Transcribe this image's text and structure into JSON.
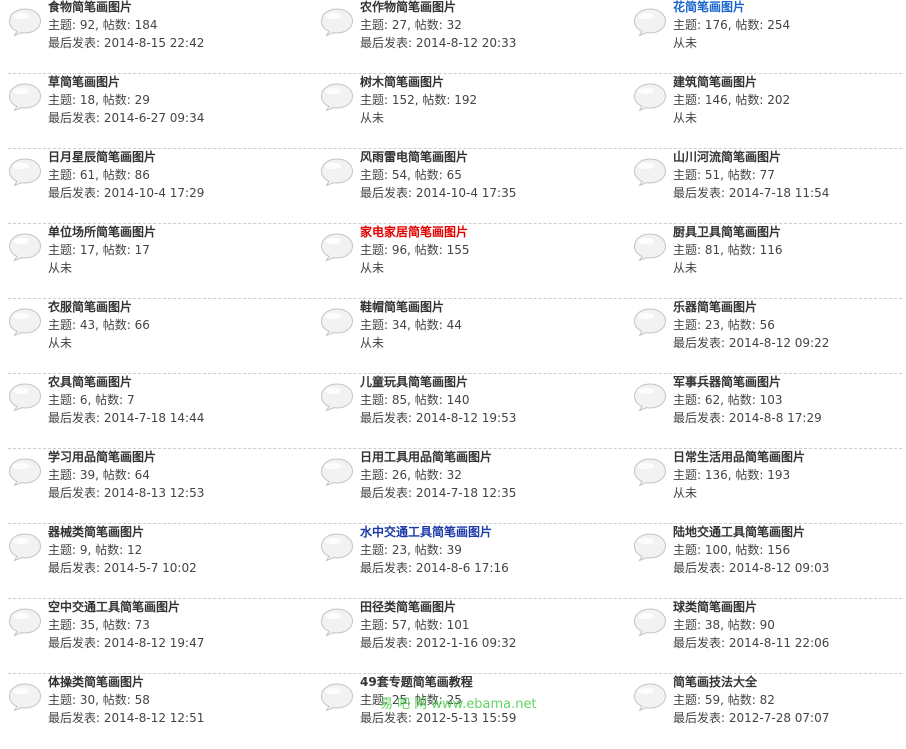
{
  "colors": {
    "title_default": "#333333",
    "title_blue": "#1a66cc",
    "title_red": "#e00000",
    "title_navy": "#1a3aa8",
    "bubble_fill": "#f2f2f2",
    "bubble_stroke": "#c4c4c4",
    "separator": "#cdcdcd",
    "watermark": "#4fcf4f"
  },
  "icon": "speech-bubble-icon",
  "rows": [
    [
      {
        "title": "食物简笔画图片",
        "stats": "主题: 92, 帖数: 184",
        "last": "最后发表: 2014-8-15 22:42",
        "color": "#333333"
      },
      {
        "title": "农作物简笔画图片",
        "stats": "主题: 27, 帖数: 32",
        "last": "最后发表: 2014-8-12 20:33",
        "color": "#333333"
      },
      {
        "title": "花简笔画图片",
        "stats": "主题: 176, 帖数: 254",
        "last": "从未",
        "color": "#1a66cc"
      }
    ],
    [
      {
        "title": "草简笔画图片",
        "stats": "主题: 18, 帖数: 29",
        "last": "最后发表: 2014-6-27 09:34",
        "color": "#333333"
      },
      {
        "title": "树木简笔画图片",
        "stats": "主题: 152, 帖数: 192",
        "last": "从未",
        "color": "#333333"
      },
      {
        "title": "建筑简笔画图片",
        "stats": "主题: 146, 帖数: 202",
        "last": "从未",
        "color": "#333333"
      }
    ],
    [
      {
        "title": "日月星辰简笔画图片",
        "stats": "主题: 61, 帖数: 86",
        "last": "最后发表: 2014-10-4 17:29",
        "color": "#333333"
      },
      {
        "title": "风雨雷电简笔画图片",
        "stats": "主题: 54, 帖数: 65",
        "last": "最后发表: 2014-10-4 17:35",
        "color": "#333333"
      },
      {
        "title": "山川河流简笔画图片",
        "stats": "主题: 51, 帖数: 77",
        "last": "最后发表: 2014-7-18 11:54",
        "color": "#333333"
      }
    ],
    [
      {
        "title": "单位场所简笔画图片",
        "stats": "主题: 17, 帖数: 17",
        "last": "从未",
        "color": "#333333"
      },
      {
        "title": "家电家居简笔画图片",
        "stats": "主题: 96, 帖数: 155",
        "last": "从未",
        "color": "#e00000"
      },
      {
        "title": "厨具卫具简笔画图片",
        "stats": "主题: 81, 帖数: 116",
        "last": "从未",
        "color": "#333333"
      }
    ],
    [
      {
        "title": "衣服简笔画图片",
        "stats": "主题: 43, 帖数: 66",
        "last": "从未",
        "color": "#333333"
      },
      {
        "title": "鞋帽简笔画图片",
        "stats": "主题: 34, 帖数: 44",
        "last": "从未",
        "color": "#333333"
      },
      {
        "title": "乐器简笔画图片",
        "stats": "主题: 23, 帖数: 56",
        "last": "最后发表: 2014-8-12 09:22",
        "color": "#333333"
      }
    ],
    [
      {
        "title": "农具简笔画图片",
        "stats": "主题: 6, 帖数: 7",
        "last": "最后发表: 2014-7-18 14:44",
        "color": "#333333"
      },
      {
        "title": "儿童玩具简笔画图片",
        "stats": "主题: 85, 帖数: 140",
        "last": "最后发表: 2014-8-12 19:53",
        "color": "#333333"
      },
      {
        "title": "军事兵器简笔画图片",
        "stats": "主题: 62, 帖数: 103",
        "last": "最后发表: 2014-8-8 17:29",
        "color": "#333333"
      }
    ],
    [
      {
        "title": "学习用品简笔画图片",
        "stats": "主题: 39, 帖数: 64",
        "last": "最后发表: 2014-8-13 12:53",
        "color": "#333333"
      },
      {
        "title": "日用工具用品简笔画图片",
        "stats": "主题: 26, 帖数: 32",
        "last": "最后发表: 2014-7-18 12:35",
        "color": "#333333"
      },
      {
        "title": "日常生活用品简笔画图片",
        "stats": "主题: 136, 帖数: 193",
        "last": "从未",
        "color": "#333333"
      }
    ],
    [
      {
        "title": "器械类简笔画图片",
        "stats": "主题: 9, 帖数: 12",
        "last": "最后发表: 2014-5-7 10:02",
        "color": "#333333"
      },
      {
        "title": "水中交通工具简笔画图片",
        "stats": "主题: 23, 帖数: 39",
        "last": "最后发表: 2014-8-6 17:16",
        "color": "#1a3aa8"
      },
      {
        "title": "陆地交通工具简笔画图片",
        "stats": "主题: 100, 帖数: 156",
        "last": "最后发表: 2014-8-12 09:03",
        "color": "#333333"
      }
    ],
    [
      {
        "title": "空中交通工具简笔画图片",
        "stats": "主题: 35, 帖数: 73",
        "last": "最后发表: 2014-8-12 19:47",
        "color": "#333333"
      },
      {
        "title": "田径类简笔画图片",
        "stats": "主题: 57, 帖数: 101",
        "last": "最后发表: 2012-1-16 09:32",
        "color": "#333333"
      },
      {
        "title": "球类简笔画图片",
        "stats": "主题: 38, 帖数: 90",
        "last": "最后发表: 2014-8-11 22:06",
        "color": "#333333"
      }
    ],
    [
      {
        "title": "体操类简笔画图片",
        "stats": "主题: 30, 帖数: 58",
        "last": "最后发表: 2014-8-12 12:51",
        "color": "#333333"
      },
      {
        "title": "49套专题简笔画教程",
        "stats": "主题: 25, 帖数: 25",
        "last": "最后发表: 2012-5-13 15:59",
        "color": "#333333"
      },
      {
        "title": "简笔画技法大全",
        "stats": "主题: 59, 帖数: 82",
        "last": "最后发表: 2012-7-28 07:07",
        "color": "#333333"
      }
    ]
  ],
  "watermark": "易 吧 网   www.ebama.net"
}
